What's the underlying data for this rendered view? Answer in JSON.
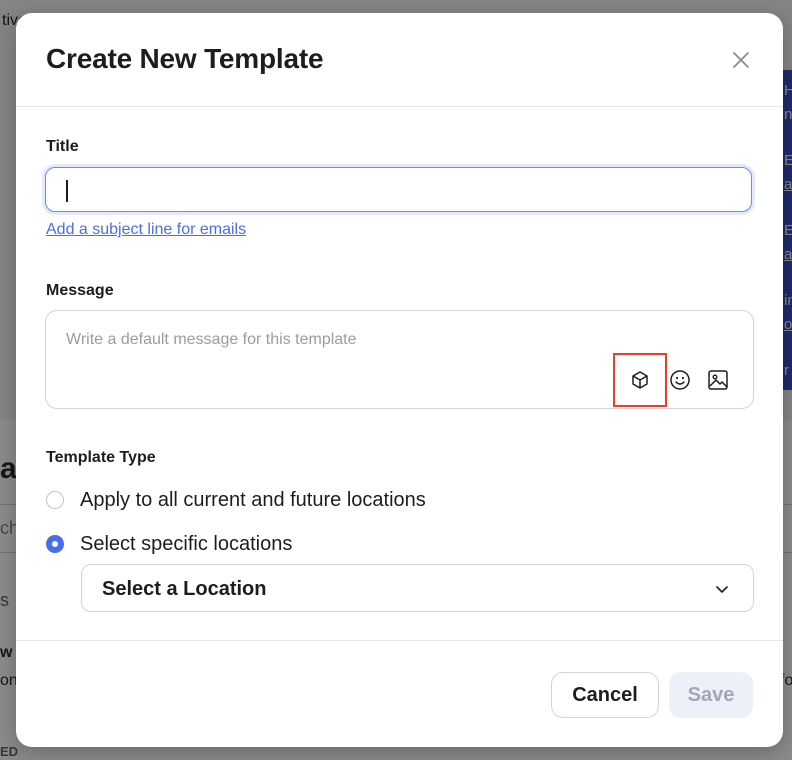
{
  "background": {
    "fragments": [
      "tive",
      "ate",
      "ch",
      "s",
      "w",
      "ont",
      "ED",
      "H",
      "ne",
      "E",
      "a",
      "E",
      "ai",
      "in",
      "o",
      "r",
      "fo"
    ]
  },
  "modal": {
    "title": "Create New Template",
    "close_icon": "close-icon"
  },
  "form": {
    "title_label": "Title",
    "title_value": "",
    "subject_link": "Add a subject line for emails",
    "message_label": "Message",
    "message_placeholder": "Write a default message for this template",
    "message_tools": [
      "cube-icon",
      "emoji-icon",
      "image-icon"
    ],
    "template_type_label": "Template Type",
    "template_type_options": [
      {
        "label": "Apply to all current and future locations",
        "checked": false
      },
      {
        "label": "Select specific locations",
        "checked": true
      }
    ],
    "location_select_value": "Select a Location"
  },
  "footer": {
    "cancel_label": "Cancel",
    "save_label": "Save"
  },
  "colors": {
    "accent": "#4a6ee8",
    "highlight": "#e5402a",
    "save_disabled_bg": "#eef0f8"
  }
}
